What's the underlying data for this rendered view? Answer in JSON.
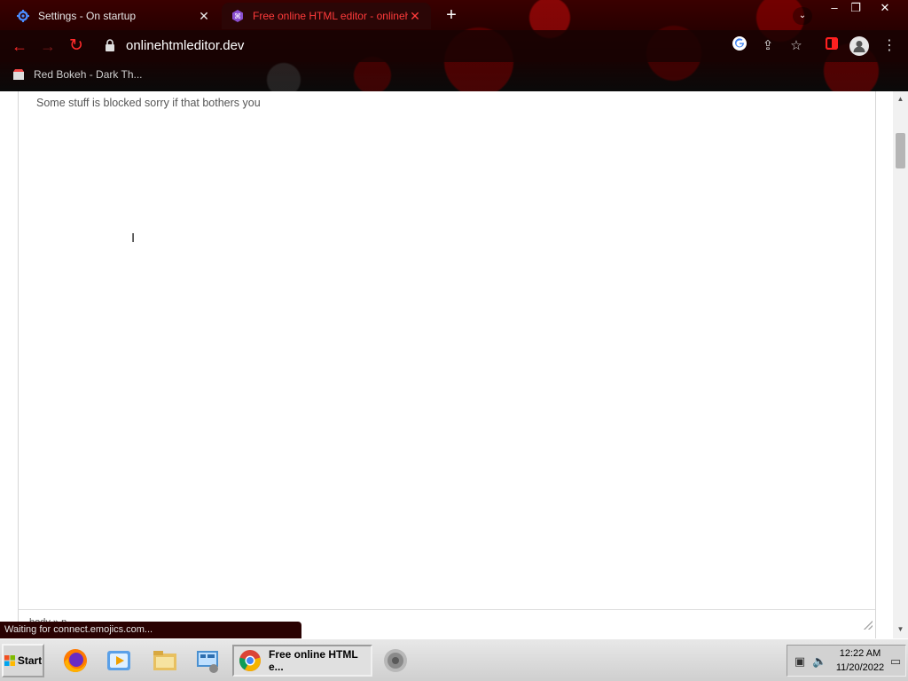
{
  "tabs": [
    {
      "title": "Settings - On startup",
      "icon": "gear-icon",
      "active": false
    },
    {
      "title": "Free online HTML editor - onlinehtm",
      "icon": "editor-logo-icon",
      "active": true
    }
  ],
  "toolbar": {
    "url": "onlinehtmleditor.dev"
  },
  "bookmarks": [
    {
      "label": "Red Bokeh - Dark Th..."
    }
  ],
  "editor": {
    "text": "Some stuff is blocked sorry if that bothers you",
    "path_label": "body » p"
  },
  "status_bar": {
    "text": "Waiting for connect.emojics.com..."
  },
  "taskbar": {
    "start_label": "Start",
    "active_task": "Free online HTML e...",
    "clock_time": "12:22 AM",
    "clock_date": "11/20/2022"
  },
  "colors": {
    "accent": "#ff2a2a",
    "chrome_dark": "#1b0000"
  }
}
